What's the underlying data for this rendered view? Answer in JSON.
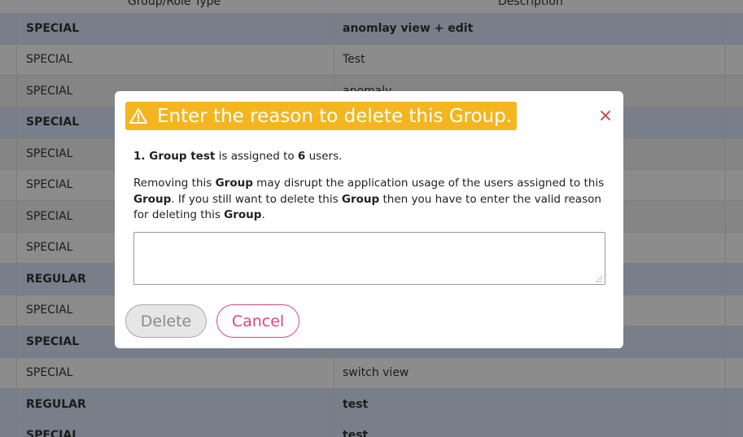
{
  "table": {
    "headers": [
      "Group/Role Type",
      "Description"
    ],
    "rows": [
      {
        "type": "SPECIAL",
        "description": "anomlay view + edit",
        "highlight": true
      },
      {
        "type": "SPECIAL",
        "description": "Test",
        "highlight": false
      },
      {
        "type": "SPECIAL",
        "description": "anomaly",
        "highlight": false
      },
      {
        "type": "SPECIAL",
        "description": "",
        "highlight": true
      },
      {
        "type": "SPECIAL",
        "description": "",
        "highlight": false
      },
      {
        "type": "SPECIAL",
        "description": "",
        "highlight": false
      },
      {
        "type": "SPECIAL",
        "description": "",
        "highlight": false
      },
      {
        "type": "SPECIAL",
        "description": "",
        "highlight": false
      },
      {
        "type": "REGULAR",
        "description": "",
        "highlight": true
      },
      {
        "type": "SPECIAL",
        "description": "",
        "highlight": false
      },
      {
        "type": "SPECIAL",
        "description": "",
        "highlight": true
      },
      {
        "type": "SPECIAL",
        "description": "switch view",
        "highlight": false
      },
      {
        "type": "REGULAR",
        "description": "test",
        "highlight": true
      },
      {
        "type": "SPECIAL",
        "description": "test",
        "highlight": true
      }
    ]
  },
  "modal": {
    "title": "Enter the reason to delete this Group.",
    "line1": {
      "prefix": "1. ",
      "entity": "Group test",
      "middle": " is assigned to ",
      "count": "6",
      "suffix": " users."
    },
    "line2": {
      "p1": "Removing this ",
      "b1": "Group",
      "p2": " may disrupt the application usage of the users assigned to this ",
      "b2": "Group",
      "p3": ". If you still want to delete this ",
      "b3": "Group",
      "p4": " then you have to enter the valid reason for deleting this ",
      "b4": "Group",
      "p5": "."
    },
    "reason_value": "",
    "delete_label": "Delete",
    "cancel_label": "Cancel"
  },
  "icons": {
    "title_icon": "warning-icon",
    "close_icon": "close-icon",
    "resize_icon": "resize-grip-icon"
  },
  "colors": {
    "title_bg": "#f4b51e",
    "close": "#d9373f",
    "cancel": "#e0457b",
    "highlight_row": "#dbe8fb"
  }
}
